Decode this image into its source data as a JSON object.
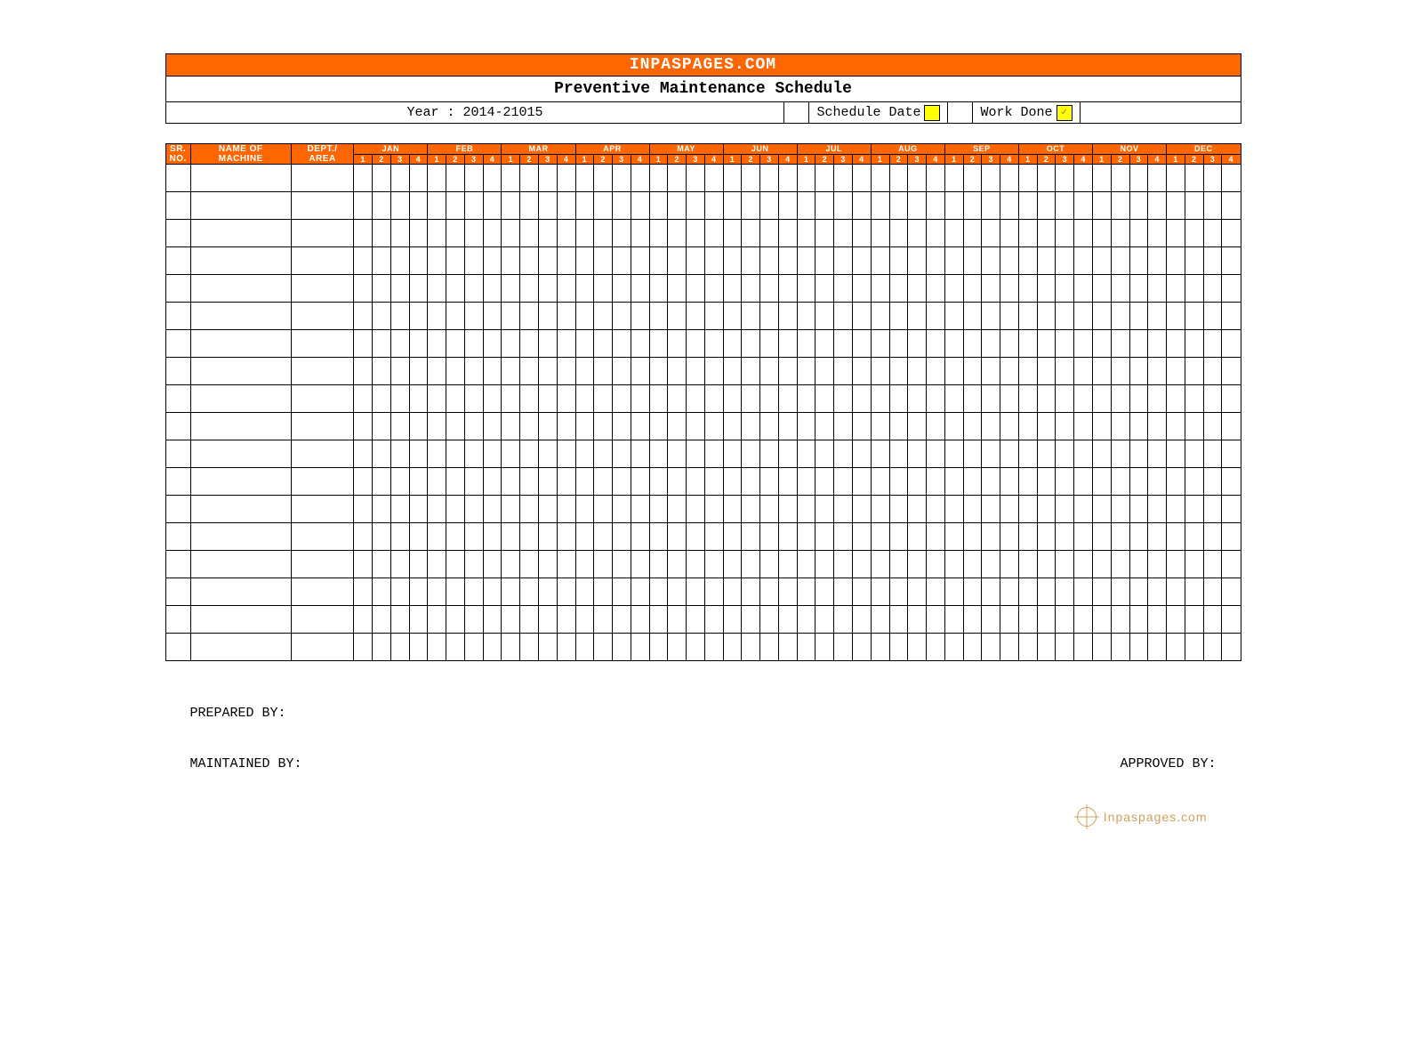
{
  "header": {
    "banner": "INPASPAGES.COM",
    "title": "Preventive Maintenance Schedule",
    "year_label": "Year : 2014-21015",
    "legend_schedule": "Schedule Date",
    "legend_workdone": "Work Done",
    "workdone_mark": "✓"
  },
  "columns": {
    "sr": "SR. NO.",
    "name": "NAME OF MACHINE",
    "dept": "DEPT./ AREA",
    "months": [
      "JAN",
      "FEB",
      "MAR",
      "APR",
      "MAY",
      "JUN",
      "JUL",
      "AUG",
      "SEP",
      "OCT",
      "NOV",
      "DEC"
    ],
    "weeks": [
      "1",
      "2",
      "3",
      "4"
    ]
  },
  "row_count": 18,
  "footer": {
    "prepared": "PREPARED BY:",
    "maintained": "MAINTAINED BY:",
    "approved": "APPROVED BY:",
    "watermark": "Inpaspages.com"
  }
}
